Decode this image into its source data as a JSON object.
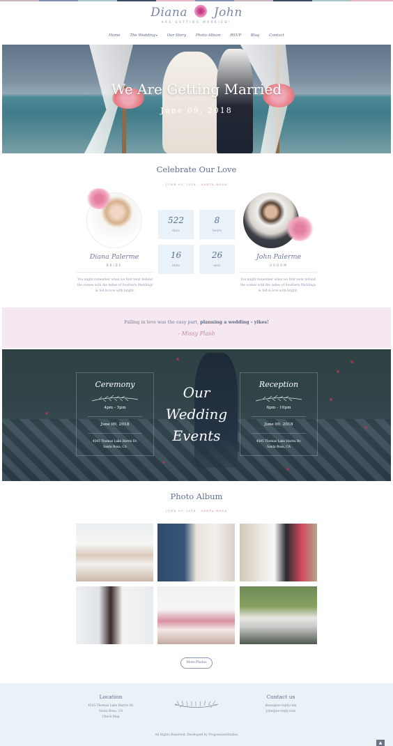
{
  "logo": {
    "bride_name": "Diana",
    "groom_name": "John",
    "tagline": "ARE GETTING MARRIED!"
  },
  "nav": {
    "items": [
      "Home",
      "The Wedding",
      "Our Story",
      "Photo Album",
      "RSVP",
      "Blog",
      "Contact"
    ]
  },
  "hero": {
    "title": "We Are Getting Married",
    "date": "June 09, 2018"
  },
  "celebrate": {
    "title": "Celebrate Our Love",
    "subtitle": "JUNE 09, 2018 - SANTA ROSA",
    "bride": {
      "name": "Diana Palerme",
      "role": "BRIDE",
      "desc": "You might remember when we first went behind the scenes with the ladies of Southern Weddings & fell in love with bright."
    },
    "groom": {
      "name": "John Palerme",
      "role": "GROOM",
      "desc": "You might remember when we first went behind the scenes with the ladies of Southern Weddings & fell in love with bright."
    },
    "countdown": [
      {
        "value": "522",
        "label": "days"
      },
      {
        "value": "8",
        "label": "hours"
      },
      {
        "value": "16",
        "label": "mins"
      },
      {
        "value": "26",
        "label": "secs"
      }
    ]
  },
  "quote": {
    "text": "Falling in love was the easy part,",
    "emphasis": "planning a wedding - yikes!",
    "author": "- Missy Plash"
  },
  "events": {
    "title_line1": "Our",
    "title_line2": "Wedding",
    "title_line3": "Events",
    "ceremony": {
      "name": "Ceremony",
      "time": "4pm - 5pm",
      "date": "June 09, 2018",
      "addr1": "4545 Thomas Lake Harris Dr.",
      "addr2": "Santa Rosa, CA"
    },
    "reception": {
      "name": "Reception",
      "time": "6pm - 10pm",
      "date": "June 09, 2018",
      "addr1": "4545 Thomas Lake Harris Dr.",
      "addr2": "Santa Rosa, CA"
    }
  },
  "album": {
    "title": "Photo Album",
    "subtitle": "JUNE 09, 2018 - SANTA ROSA",
    "button": "More Photos"
  },
  "footer": {
    "location_title": "Location",
    "location_line1": "4545 Thomas Lake Harris Dr.",
    "location_line2": "Santa Rosa, CA",
    "location_link": "Check Map",
    "contact_title": "Contact us",
    "contact_line1": "diana@no-reply.com",
    "contact_line2": "john@no-reply.com",
    "copyright": "All Rights Reserved. Developed by ProgressionStudios"
  },
  "colors": {
    "accent_blue": "#5f6e8c",
    "accent_pink": "#c08aa0",
    "quote_band": "#f6e8f0",
    "countdown_box": "#e8f2f8",
    "footer_bg": "#eaf2f8"
  }
}
